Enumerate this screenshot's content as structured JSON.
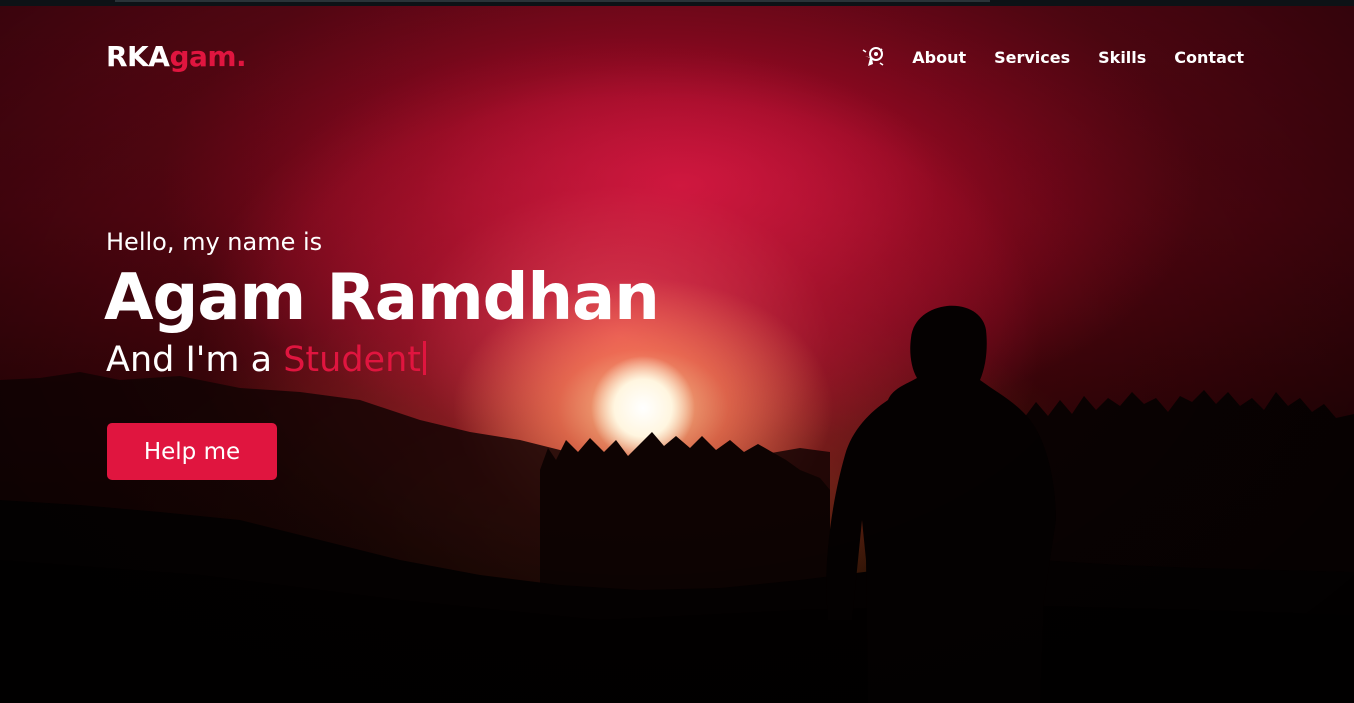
{
  "brand": {
    "logo_main": "RKA",
    "logo_accent": "gam.",
    "accent_color": "#e0153f"
  },
  "nav": {
    "icon": "rocket-emoji-icon",
    "items": [
      {
        "label": "About"
      },
      {
        "label": "Services"
      },
      {
        "label": "Skills"
      },
      {
        "label": "Contact"
      }
    ]
  },
  "hero": {
    "greeting": "Hello, my name is",
    "name": "Agam Ramdhan",
    "role_prefix": "And I'm a ",
    "role": "Student",
    "cta_label": "Help me"
  }
}
